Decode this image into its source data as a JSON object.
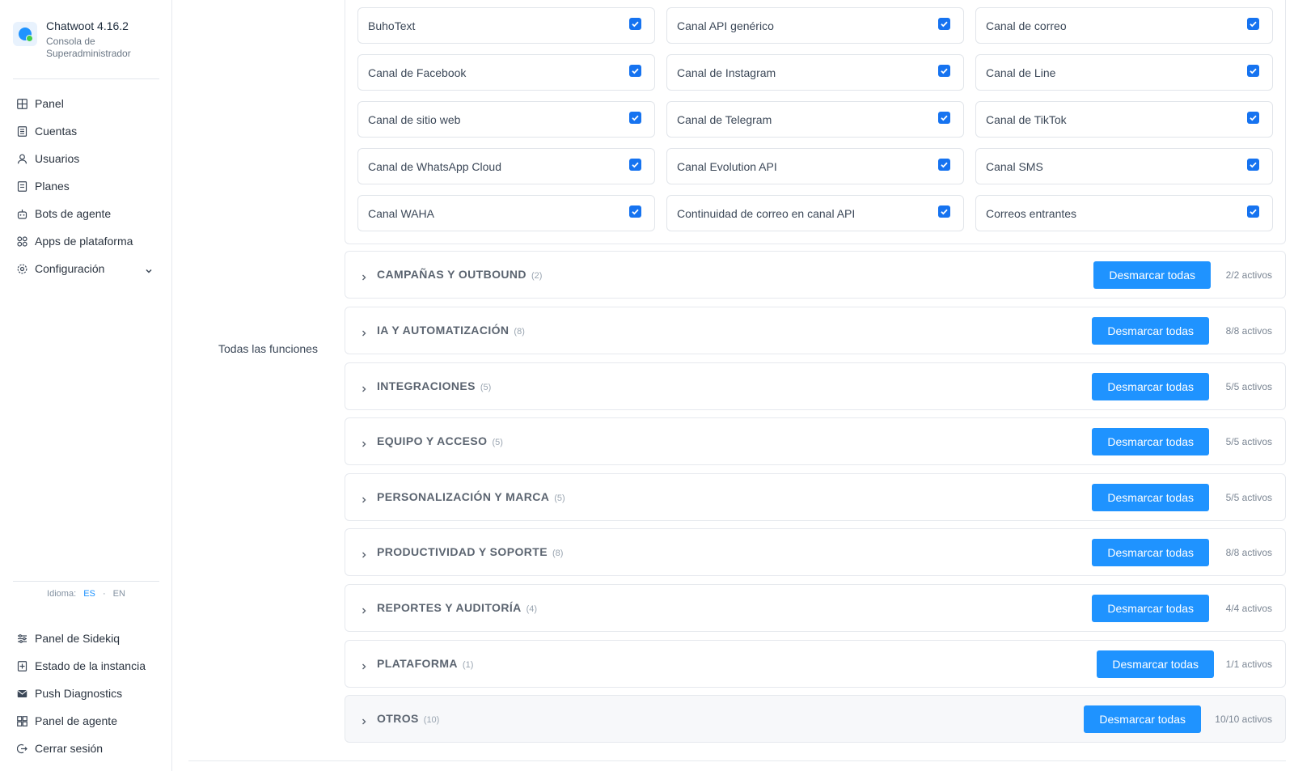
{
  "brand": {
    "title": "Chatwoot 4.16.2",
    "subtitle": "Consola de Superadministrador",
    "accent": "#1f93ff"
  },
  "nav": {
    "items": [
      {
        "label": "Panel",
        "icon": "grid-icon"
      },
      {
        "label": "Cuentas",
        "icon": "building-icon"
      },
      {
        "label": "Usuarios",
        "icon": "user-icon"
      },
      {
        "label": "Planes",
        "icon": "receipt-icon"
      },
      {
        "label": "Bots de agente",
        "icon": "bot-icon"
      },
      {
        "label": "Apps de plataforma",
        "icon": "apps-icon"
      },
      {
        "label": "Configuración",
        "icon": "gear-icon"
      }
    ],
    "bottom_items": [
      {
        "label": "Panel de Sidekiq",
        "icon": "sliders-icon"
      },
      {
        "label": "Estado de la instancia",
        "icon": "status-icon"
      },
      {
        "label": "Push Diagnostics",
        "icon": "mail-icon"
      },
      {
        "label": "Panel de agente",
        "icon": "dashboard-icon"
      },
      {
        "label": "Cerrar sesión",
        "icon": "logout-icon"
      }
    ]
  },
  "language": {
    "label": "Idioma:",
    "options": [
      "ES",
      "EN"
    ],
    "separator": "·",
    "selected": "ES"
  },
  "main": {
    "section_label": "Todas las funciones",
    "channels": [
      {
        "label": "BuhoText",
        "checked": true
      },
      {
        "label": "Canal API genérico",
        "checked": true
      },
      {
        "label": "Canal de correo",
        "checked": true
      },
      {
        "label": "Canal de Facebook",
        "checked": true
      },
      {
        "label": "Canal de Instagram",
        "checked": true
      },
      {
        "label": "Canal de Line",
        "checked": true
      },
      {
        "label": "Canal de sitio web",
        "checked": true
      },
      {
        "label": "Canal de Telegram",
        "checked": true
      },
      {
        "label": "Canal de TikTok",
        "checked": true
      },
      {
        "label": "Canal de WhatsApp Cloud",
        "checked": true
      },
      {
        "label": "Canal Evolution API",
        "checked": true
      },
      {
        "label": "Canal SMS",
        "checked": true
      },
      {
        "label": "Canal WAHA",
        "checked": true
      },
      {
        "label": "Continuidad de correo en canal API",
        "checked": true
      },
      {
        "label": "Correos entrantes",
        "checked": true
      }
    ],
    "categories": [
      {
        "title": "CAMPAÑAS Y OUTBOUND",
        "count": "(2)",
        "button": "Desmarcar todas",
        "status": "2/2 activos"
      },
      {
        "title": "IA Y AUTOMATIZACIÓN",
        "count": "(8)",
        "button": "Desmarcar todas",
        "status": "8/8 activos"
      },
      {
        "title": "INTEGRACIONES",
        "count": "(5)",
        "button": "Desmarcar todas",
        "status": "5/5 activos"
      },
      {
        "title": "EQUIPO Y ACCESO",
        "count": "(5)",
        "button": "Desmarcar todas",
        "status": "5/5 activos"
      },
      {
        "title": "PERSONALIZACIÓN Y MARCA",
        "count": "(5)",
        "button": "Desmarcar todas",
        "status": "5/5 activos"
      },
      {
        "title": "PRODUCTIVIDAD Y SOPORTE",
        "count": "(8)",
        "button": "Desmarcar todas",
        "status": "8/8 activos"
      },
      {
        "title": "REPORTES Y AUDITORÍA",
        "count": "(4)",
        "button": "Desmarcar todas",
        "status": "4/4 activos"
      },
      {
        "title": "PLATAFORMA",
        "count": "(1)",
        "button": "Desmarcar todas",
        "status": "1/1 activos"
      },
      {
        "title": "OTROS",
        "count": "(10)",
        "button": "Desmarcar todas",
        "status": "10/10 activos"
      }
    ]
  }
}
